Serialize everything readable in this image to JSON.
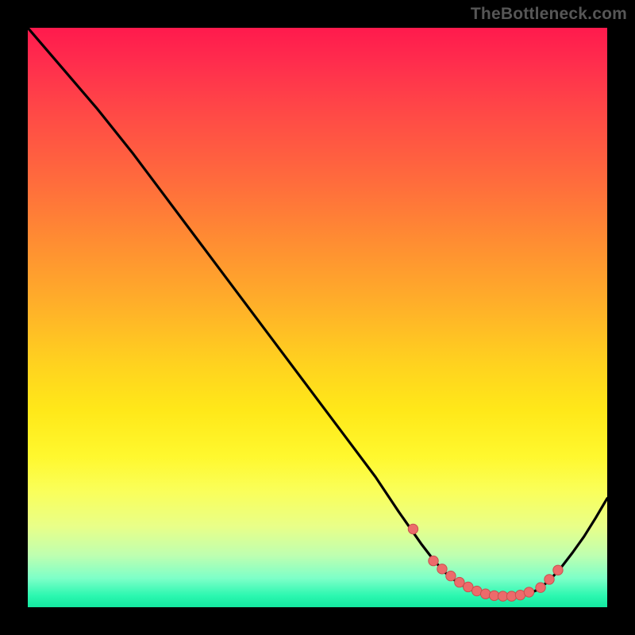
{
  "attribution": "TheBottleneck.com",
  "colors": {
    "dot_fill": "#ec6b6b",
    "dot_stroke": "#c94f4f",
    "curve": "#000000"
  },
  "chart_data": {
    "type": "line",
    "title": "",
    "xlabel": "",
    "ylabel": "",
    "xlim": [
      0,
      100
    ],
    "ylim": [
      0,
      100
    ],
    "annotations": [
      {
        "text": "TheBottleneck.com",
        "position": "top-right"
      }
    ],
    "series": [
      {
        "name": "bottleneck-curve",
        "x": [
          0,
          6,
          12,
          18,
          24,
          30,
          36,
          42,
          48,
          54,
          60,
          64,
          68,
          70,
          72,
          74,
          76,
          78,
          80,
          82,
          84,
          86,
          88,
          90,
          92,
          94,
          96,
          98,
          100
        ],
        "y": [
          100,
          93,
          86,
          78.5,
          70.5,
          62.5,
          54.5,
          46.5,
          38.5,
          30.5,
          22.5,
          16.5,
          10.8,
          8.2,
          6.0,
          4.4,
          3.2,
          2.4,
          2.0,
          1.9,
          1.9,
          2.2,
          3.0,
          4.6,
          6.8,
          9.4,
          12.2,
          15.4,
          18.8
        ]
      }
    ],
    "dots": {
      "x": [
        66.5,
        70.0,
        71.5,
        73.0,
        74.5,
        76.0,
        77.5,
        79.0,
        80.5,
        82.0,
        83.5,
        85.0,
        86.5,
        88.5,
        90.0,
        91.5
      ],
      "y": [
        13.5,
        8.0,
        6.6,
        5.4,
        4.3,
        3.5,
        2.8,
        2.3,
        2.0,
        1.9,
        1.9,
        2.1,
        2.6,
        3.4,
        4.8,
        6.4
      ]
    }
  }
}
